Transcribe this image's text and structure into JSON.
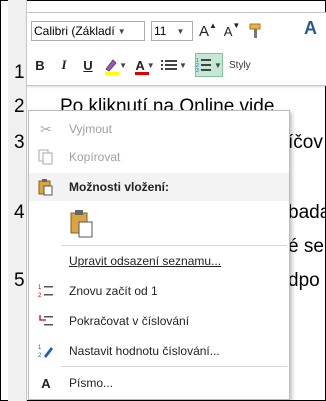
{
  "doc": {
    "line_numbers": [
      "1",
      "2",
      "3",
      "4",
      "5"
    ],
    "line2_text": "Po kliknutí na Online vide",
    "fragments": [
      "íčov",
      "bada",
      "é se",
      "dpo"
    ]
  },
  "mini_toolbar": {
    "font_name": "Calibri (Základí",
    "font_size": "11",
    "grow_font": "A",
    "shrink_font": "A",
    "bold": "B",
    "italic": "I",
    "underline": "U",
    "font_color": "A",
    "styles": "Styly"
  },
  "context_menu": {
    "items": [
      {
        "label": "Vyjmout",
        "icon": "scissors-icon",
        "disabled": true
      },
      {
        "label": "Kopírovat",
        "icon": "copy-icon",
        "disabled": true
      },
      {
        "label": "Možnosti vložení:",
        "icon": "paste-icon",
        "header": true
      },
      {
        "label": "Upravit odsazení seznamu...",
        "icon": ""
      },
      {
        "label": "Znovu začít od 1",
        "icon": "restart-numbering-icon"
      },
      {
        "label": "Pokračovat v číslování",
        "icon": "continue-numbering-icon"
      },
      {
        "label": "Nastavit hodnotu číslování...",
        "icon": "set-numbering-value-icon"
      },
      {
        "label": "Písmo...",
        "icon": "font-icon"
      }
    ],
    "font_icon_glyph": "A"
  },
  "colors": {
    "highlight": "#ffff00",
    "font_color": "#e00000",
    "active_button": "#c5e8d4"
  }
}
